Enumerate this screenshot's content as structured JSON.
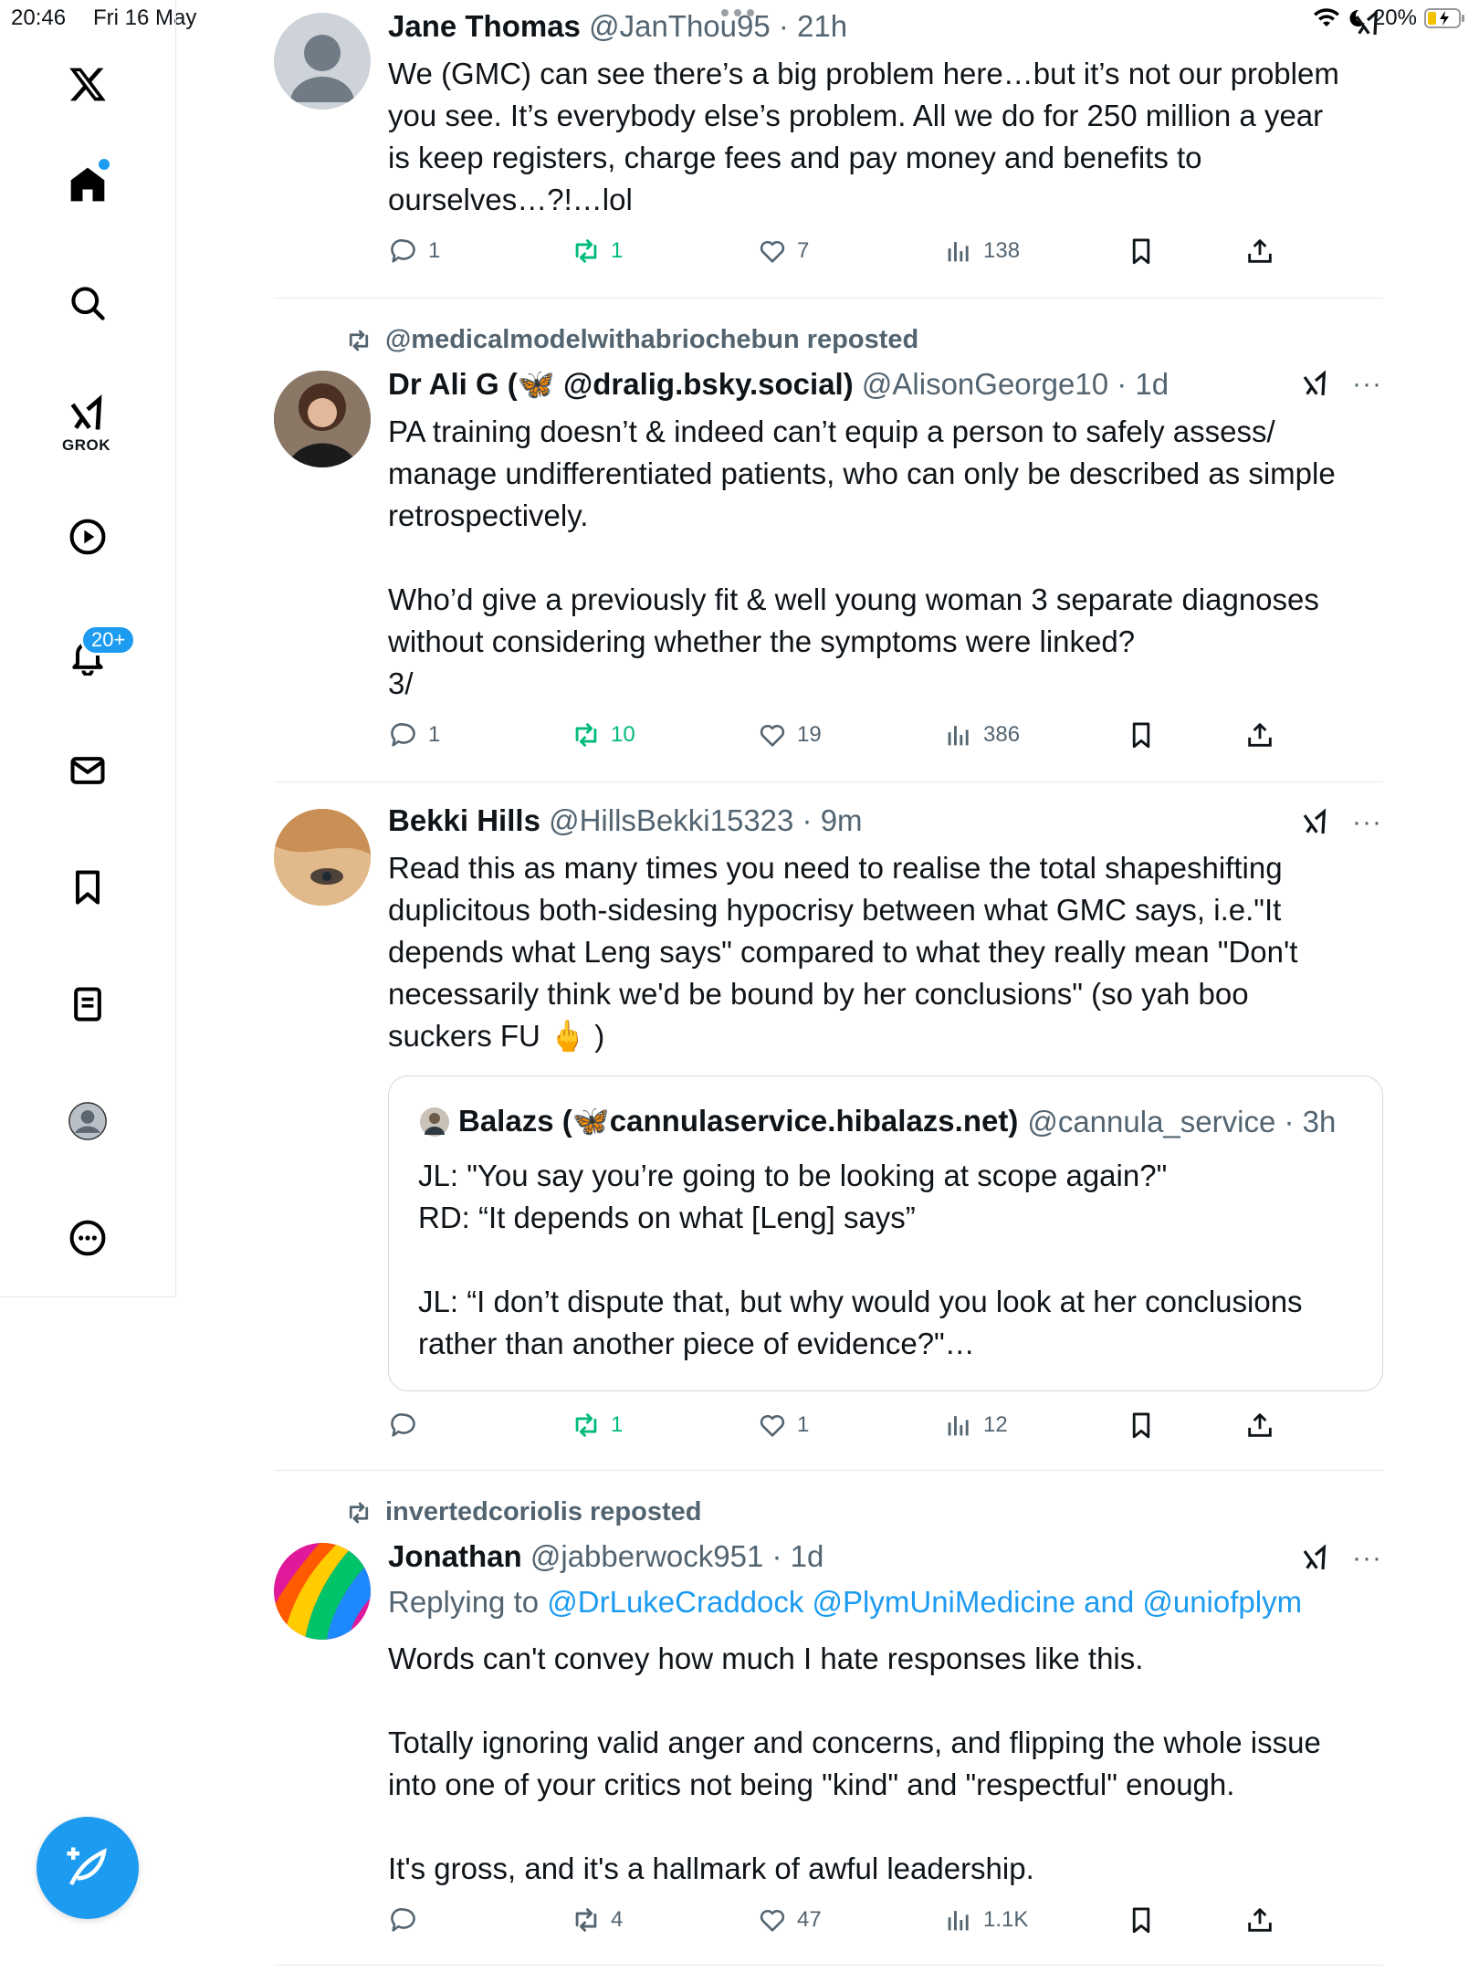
{
  "status_bar": {
    "time": "20:46",
    "date": "Fri 16 May",
    "battery": "20%"
  },
  "sidebar": {
    "items": [
      {
        "label": "Home"
      },
      {
        "label": "Search"
      },
      {
        "label": "GROK"
      },
      {
        "label": "Video"
      },
      {
        "label": "Notifications"
      },
      {
        "label": "Messages"
      },
      {
        "label": "Bookmarks"
      },
      {
        "label": "Lists"
      },
      {
        "label": "Profile"
      },
      {
        "label": "More"
      }
    ],
    "grok_label": "GROK",
    "notifications_badge": "20+"
  },
  "posts": [
    {
      "name": "Jane Thomas",
      "handle": "@JanThou95 · 21h",
      "text": "We (GMC) can see there’s a big problem here…but it’s not our problem\nyou see. It’s everybody else’s problem. All we do for 250 million a year\nis keep registers, charge fees and pay money and benefits to\nourselves…?!…lol",
      "replies": "1",
      "reposts": "1",
      "likes": "7",
      "views": "138"
    },
    {
      "repost_by": "@medicalmodelwithabriochebun reposted",
      "name": "Dr Ali G (🦋 @dralig.bsky.social)",
      "handle": "@AlisonGeorge10 · 1d",
      "text": "PA training doesn’t & indeed can’t equip a person to safely assess/\nmanage undifferentiated patients, who can only be described as simple\nretrospectively.\n\nWho’d give a previously fit & well young woman 3 separate diagnoses\nwithout considering whether the symptoms were linked?\n3/",
      "replies": "1",
      "reposts": "10",
      "likes": "19",
      "views": "386"
    },
    {
      "name": "Bekki Hills",
      "handle": "@HillsBekki15323 · 9m",
      "text": "Read this as many times you need to realise the total shapeshifting\nduplicitous both-sidesing hypocrisy between what GMC says, i.e.\"It\ndepends what Leng says\" compared to what they really mean \"Don't\nnecessarily think we'd be bound by her conclusions\" (so yah boo\nsuckers FU 🖕 )",
      "quote": {
        "name": "Balazs (🦋cannulaservice.hibalazs.net)",
        "handle": "@cannula_service · 3h",
        "text": "JL: \"You say you’re going to be looking at scope again?\"\nRD: “It depends on what [Leng] says”\n\nJL: “I don’t dispute that, but why would you look at her conclusions\nrather than another piece of evidence?\"…"
      },
      "replies": "",
      "reposts": "1",
      "likes": "1",
      "views": "12"
    },
    {
      "repost_by": "invertedcoriolis reposted",
      "name": "Jonathan",
      "handle": "@jabberwock951 · 1d",
      "reply_prefix": "Replying to ",
      "reply_targets": "@DrLukeCraddock @PlymUniMedicine and @uniofplym",
      "text": "Words can't convey how much I hate responses like this.\n\nTotally ignoring valid anger and concerns, and flipping the whole issue\ninto one of your critics not being \"kind\" and \"respectful\" enough.\n\nIt's gross, and it's a hallmark of awful leadership.",
      "replies": "",
      "reposts": "4",
      "likes": "47",
      "views": "1.1K"
    }
  ],
  "colors": {
    "accent": "#1d9bf0",
    "repost_green": "#00ba7c",
    "muted": "#536471"
  }
}
